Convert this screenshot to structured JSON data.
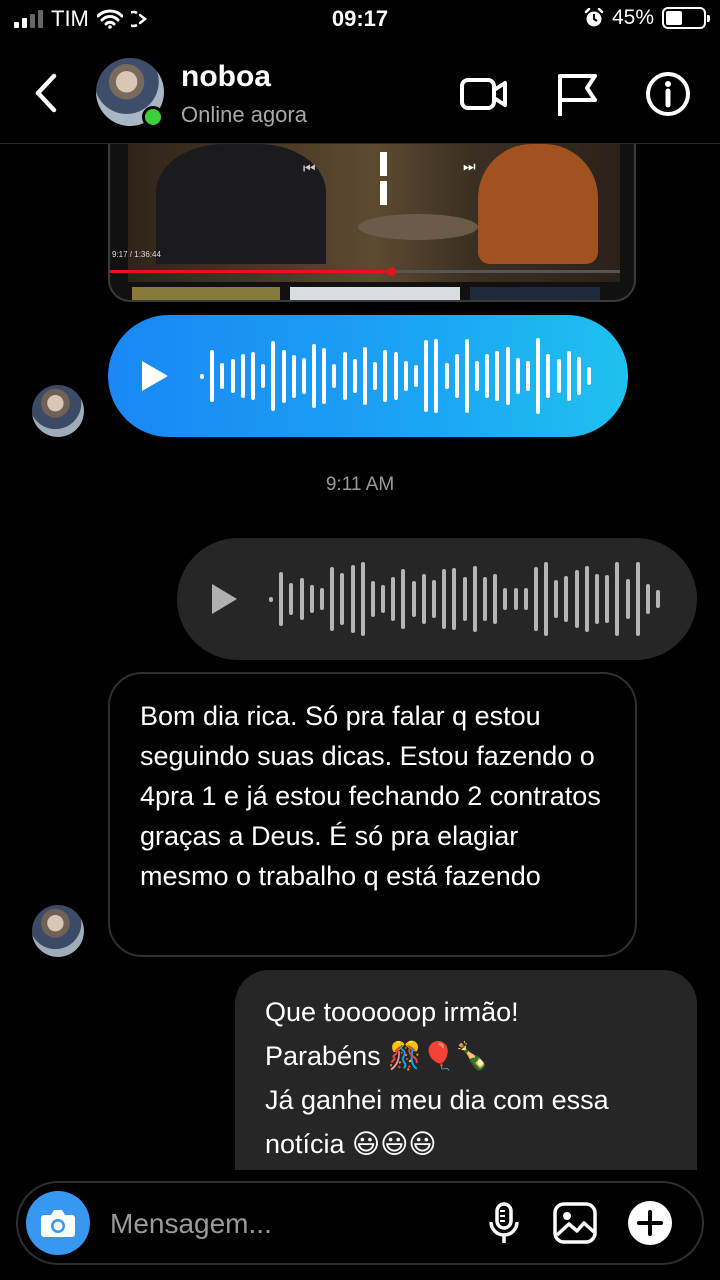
{
  "status_bar": {
    "carrier": "TIM",
    "time": "09:17",
    "battery_percent": "45%",
    "battery_level": 0.45,
    "signal_bars": 2,
    "icons": [
      "signal-icon",
      "wifi-icon",
      "call-forward-icon",
      "alarm-icon",
      "battery-icon"
    ]
  },
  "header": {
    "contact_name": "noboa",
    "contact_status": "Online agora",
    "icons": [
      "back-chevron-icon",
      "video-call-icon",
      "flag-icon",
      "info-icon"
    ],
    "online_color": "#3dcf3a"
  },
  "video": {
    "time_label": "9:17 / 1:36:44",
    "progress": 0.55,
    "icons": [
      "previous-icon",
      "pause-icon",
      "next-icon"
    ]
  },
  "voice_in": {
    "color": "#1a9af5",
    "icon": "play-icon"
  },
  "timestamp": "9:11 AM",
  "voice_out": {
    "color": "#262626",
    "icon": "play-icon"
  },
  "message_in": {
    "text": "Bom dia rica. Só pra falar q estou seguindo suas dicas. Estou fazendo o 4pra 1 e já estou fechando 2 contratos graças a Deus. É só pra elagiar mesmo o trabalho q está fazendo"
  },
  "message_out": {
    "lines": [
      "Que toooooop irmão!",
      "Parabéns 🎊🎈🍾",
      "Já ganhei meu dia com essa",
      "notícia 😃😃😃"
    ]
  },
  "composer": {
    "placeholder": "Mensagem...",
    "icons": [
      "camera-icon",
      "microphone-icon",
      "gallery-icon",
      "add-icon"
    ],
    "accent": "#3897f0"
  }
}
